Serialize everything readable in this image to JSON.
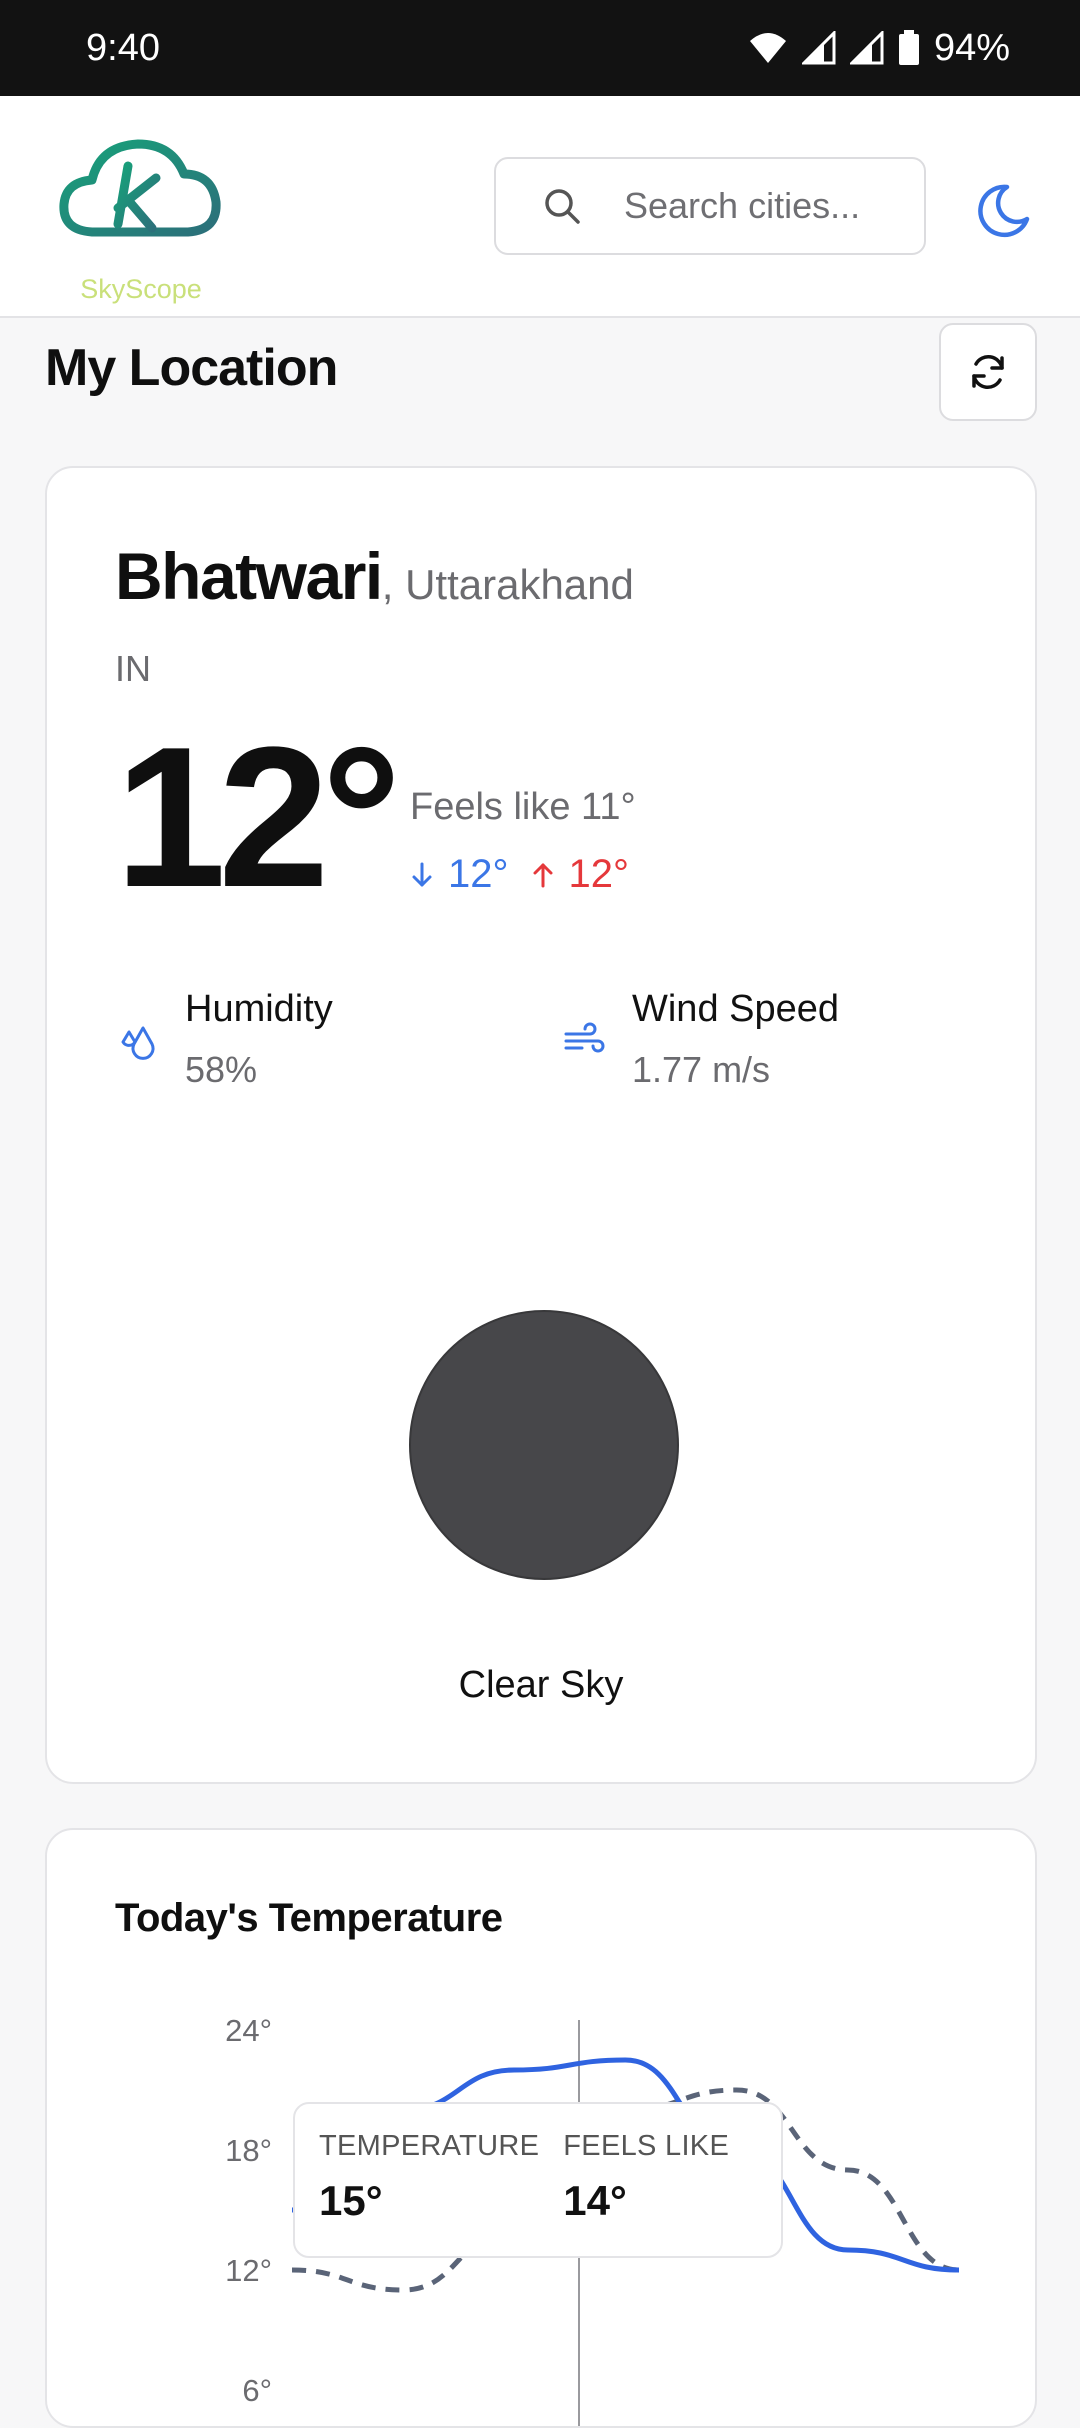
{
  "status_bar": {
    "time": "9:40",
    "battery": "94%"
  },
  "header": {
    "logo_text": "SkyScope",
    "search_placeholder": "Search cities...",
    "accent": "#3b76e6"
  },
  "section": {
    "title": "My Location"
  },
  "weather": {
    "city": "Bhatwari",
    "region": ", Uttarakhand",
    "country": "IN",
    "temperature": "12°",
    "feels_like": "Feels like 11°",
    "min": "12°",
    "max": "12°",
    "humidity_label": "Humidity",
    "humidity_value": "58%",
    "wind_label": "Wind Speed",
    "wind_value": "1.77 m/s",
    "condition": "Clear Sky"
  },
  "temperature_chart": {
    "title": "Today's Temperature",
    "tooltip": {
      "temp_label": "TEMPERATURE",
      "temp_value": "15°",
      "feels_label": "FEELS LIKE",
      "feels_value": "14°"
    }
  },
  "chart_data": {
    "type": "line",
    "title": "Today's Temperature",
    "y_ticks": [
      "24°",
      "18°",
      "12°",
      "6°"
    ],
    "ylim": [
      6,
      24
    ],
    "series": [
      {
        "name": "TEMPERATURE",
        "color": "#2f63e0",
        "values": [
          15,
          20,
          22,
          22.5,
          18,
          13,
          12
        ]
      },
      {
        "name": "FEELS LIKE",
        "color": "#5a6478",
        "values": [
          12,
          11,
          14,
          20,
          21,
          17,
          12
        ]
      }
    ],
    "grid": false
  }
}
